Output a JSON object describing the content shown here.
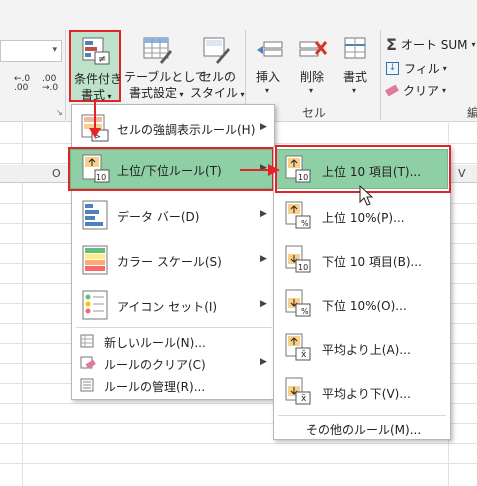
{
  "ribbon": {
    "conditional_formatting": {
      "line1": "条件付き",
      "line2": "書式"
    },
    "format_as_table": {
      "line1": "テーブルとして",
      "line2": "書式設定"
    },
    "cell_styles": {
      "line1": "セルの",
      "line2": "スタイル"
    },
    "insert": "挿入",
    "delete": "削除",
    "format": "書式",
    "cells_group": "セル",
    "autosum": "オート SUM",
    "fill": "フィル",
    "clear": "クリア",
    "edit_group_partial": "編"
  },
  "sheet": {
    "col_o": "O",
    "col_v": "V"
  },
  "menu": {
    "items": [
      {
        "label": "セルの強調表示ルール(H)",
        "icon": "highlight-cells-icon"
      },
      {
        "label": "上位/下位ルール(T)",
        "icon": "top-bottom-icon"
      },
      {
        "label": "データ バー(D)",
        "icon": "data-bars-icon"
      },
      {
        "label": "カラー スケール(S)",
        "icon": "color-scales-icon"
      },
      {
        "label": "アイコン セット(I)",
        "icon": "icon-sets-icon"
      }
    ],
    "small_items": [
      {
        "label": "新しいルール(N)..."
      },
      {
        "label": "ルールのクリア(C)"
      },
      {
        "label": "ルールの管理(R)..."
      }
    ]
  },
  "submenu": {
    "items": [
      {
        "label": "上位 10 項目(T)...",
        "badge": "10"
      },
      {
        "label": "上位 10%(P)...",
        "badge": "%"
      },
      {
        "label": "下位 10 項目(B)...",
        "badge": "10"
      },
      {
        "label": "下位 10%(O)...",
        "badge": "%"
      },
      {
        "label": "平均より上(A)...",
        "badge": "x̄"
      },
      {
        "label": "平均より下(V)...",
        "badge": "x̄"
      }
    ],
    "more_rules": "その他のルール(M)..."
  },
  "colors": {
    "highlight": "#8fcfa6",
    "annotation_red": "#e0242a"
  }
}
